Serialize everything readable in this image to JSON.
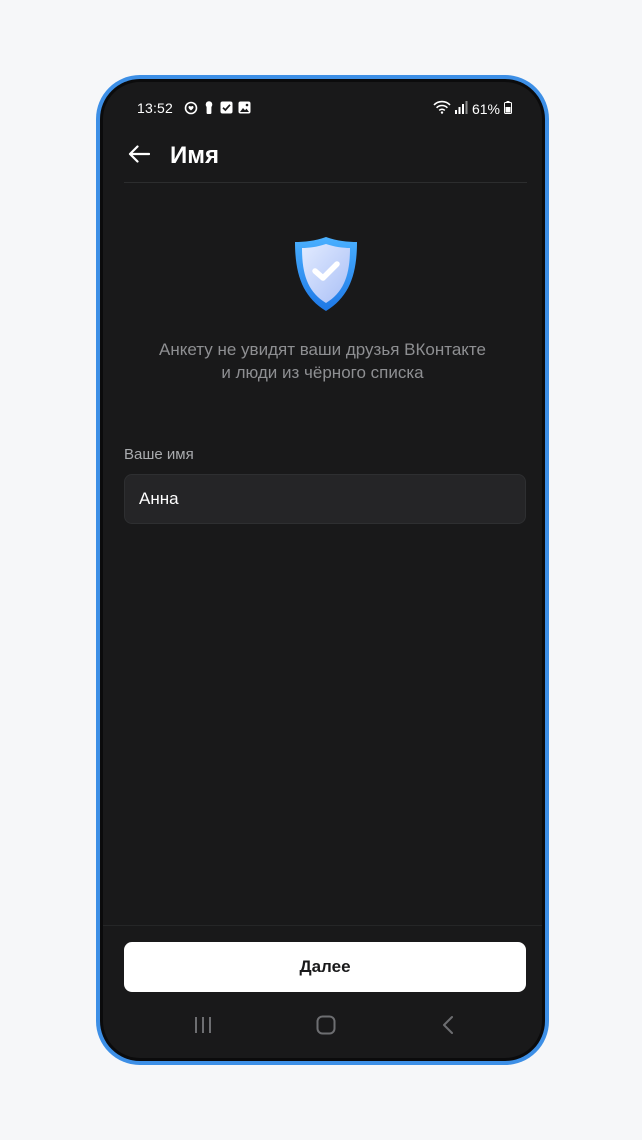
{
  "status_bar": {
    "time": "13:52",
    "battery": "61%",
    "icons_left": [
      "heart-rate-icon",
      "keyhole-icon",
      "checkbox-icon",
      "image-icon"
    ],
    "icons_right": [
      "wifi-icon",
      "signal-icon",
      "battery-icon"
    ]
  },
  "header": {
    "title": "Имя",
    "back_icon": "arrow-left-icon"
  },
  "info": {
    "icon": "shield-check-icon",
    "line1": "Анкету не увидят ваши друзья ВКонтакте",
    "line2": "и люди из чёрного списка"
  },
  "form": {
    "name_label": "Ваше имя",
    "name_value": "Анна"
  },
  "actions": {
    "next_label": "Далее"
  },
  "navbar": {
    "icons": [
      "recents-icon",
      "home-icon",
      "back-icon"
    ]
  },
  "colors": {
    "frame": "#3d8fe6",
    "background": "#19191a",
    "button": "#ffffff",
    "shield": "#2f8ff0"
  }
}
